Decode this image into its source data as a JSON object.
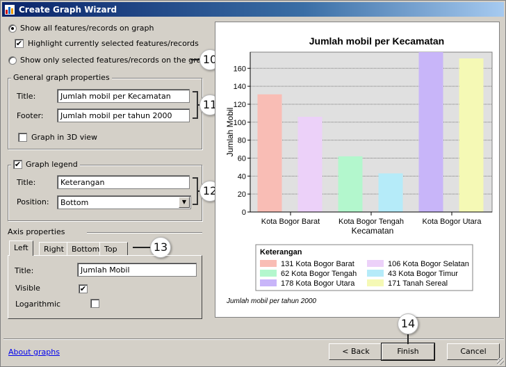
{
  "window": {
    "title": "Create Graph Wizard"
  },
  "options": {
    "show_all": "Show all features/records on graph",
    "highlight": "Highlight currently selected features/records",
    "show_selected": "Show only selected features/records on the graph"
  },
  "general": {
    "legend": "General graph properties",
    "title_label": "Title:",
    "title_value": "Jumlah mobil per Kecamatan",
    "footer_label": "Footer:",
    "footer_value": "Jumlah mobil per tahun 2000",
    "view3d": "Graph in 3D view"
  },
  "graph_legend": {
    "label": "Graph legend",
    "title_label": "Title:",
    "title_value": "Keterangan",
    "position_label": "Position:",
    "position_value": "Bottom"
  },
  "axis": {
    "legend": "Axis properties",
    "tabs": [
      "Left",
      "Right",
      "Bottom",
      "Top"
    ],
    "title_label": "Title:",
    "title_value": "Jumlah Mobil",
    "visible_label": "Visible",
    "log_label": "Logarithmic"
  },
  "callouts": [
    "10",
    "11",
    "12",
    "13",
    "14"
  ],
  "footer": {
    "about": "About graphs",
    "back": "< Back",
    "finish": "Finish",
    "cancel": "Cancel"
  },
  "chart_data": {
    "type": "bar",
    "title": "Jumlah mobil per Kecamatan",
    "xlabel": "Kecamatan",
    "ylabel": "Jumlah Mobil",
    "footer": "Jumlah mobil per tahun 2000",
    "ylim": [
      0,
      178
    ],
    "yticks": [
      0,
      20,
      40,
      60,
      80,
      100,
      120,
      140,
      160
    ],
    "grid": true,
    "categories": [
      "Kota Bogor Barat",
      "Kota Bogor Selatan",
      "Kota Bogor Tengah",
      "Kota Bogor Timur",
      "Kota Bogor Utara",
      "Tanah Sereal"
    ],
    "xtick_labels": [
      "Kota Bogor Barat",
      "Kota Bogor Tengah",
      "Kota Bogor Utara"
    ],
    "values": [
      131,
      106,
      62,
      43,
      178,
      171
    ],
    "colors": [
      "#f9bdb5",
      "#ecd1f9",
      "#b3f7cd",
      "#b5ebf9",
      "#c8b5f9",
      "#f5f9b5"
    ],
    "legend": {
      "title": "Keterangan",
      "placement": "bottom",
      "entries": [
        "131 Kota Bogor Barat",
        "106 Kota Bogor Selatan",
        "62 Kota Bogor Tengah",
        "43 Kota Bogor Timur",
        "178 Kota Bogor Utara",
        "171 Tanah Sereal"
      ]
    }
  }
}
